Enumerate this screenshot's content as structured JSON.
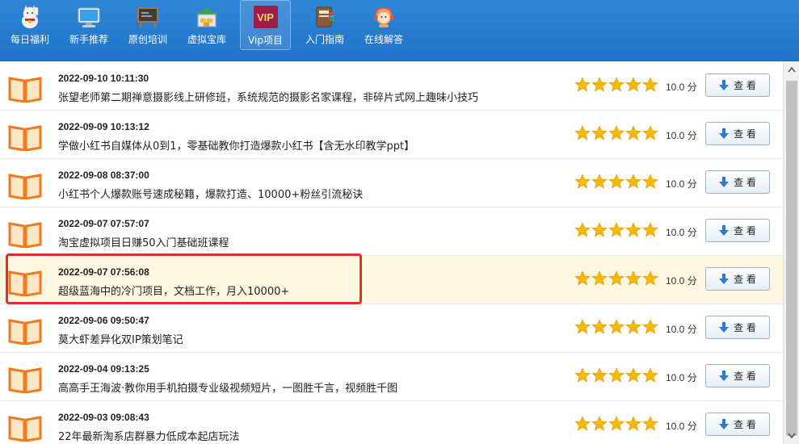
{
  "nav": {
    "items": [
      {
        "label": "每日福利",
        "icon": "lucky-cat-icon"
      },
      {
        "label": "新手推荐",
        "icon": "monitor-icon"
      },
      {
        "label": "原创培训",
        "icon": "blackboard-icon"
      },
      {
        "label": "虚拟宝库",
        "icon": "warehouse-icon"
      },
      {
        "label": "Vip项目",
        "icon": "vip-icon",
        "badge": "VIP",
        "active": true
      },
      {
        "label": "入门指南",
        "icon": "book-guide-icon"
      },
      {
        "label": "在线解答",
        "icon": "support-agent-icon"
      }
    ]
  },
  "list": {
    "view_label": "查 看",
    "rows": [
      {
        "date": "2022-09-10 10:11:30",
        "title": "张望老师第二期禅意摄影线上研修班，系统规范的摄影名家课程，非碎片式网上趣味小技巧",
        "rating": 5,
        "score": "10.0 分"
      },
      {
        "date": "2022-09-09 10:13:12",
        "title": "学做小红书自媒体从0到1，零基础教你打造爆款小红书【含无水印教学ppt】",
        "rating": 5,
        "score": "10.0 分"
      },
      {
        "date": "2022-09-08 08:37:00",
        "title": "小红书个人爆款账号速成秘籍，爆款打造、10000+粉丝引流秘诀",
        "rating": 5,
        "score": "10.0 分"
      },
      {
        "date": "2022-09-07 07:57:07",
        "title": "淘宝虚拟项目日赚50入门基础班课程",
        "rating": 5,
        "score": "10.0 分"
      },
      {
        "date": "2022-09-07 07:56:08",
        "title": "超级蓝海中的冷门项目，文档工作，月入10000+",
        "rating": 5,
        "score": "10.0 分",
        "highlight": true
      },
      {
        "date": "2022-09-06 09:50:47",
        "title": "莫大虾差异化双IP策划笔记",
        "rating": 5,
        "score": "10.0 分"
      },
      {
        "date": "2022-09-04 09:13:25",
        "title": "高高手王海波·教你用手机拍摄专业级视频短片，一图胜千言，视频胜千图",
        "rating": 5,
        "score": "10.0 分"
      },
      {
        "date": "2022-09-03 09:08:43",
        "title": "22年最新淘系店群暴力低成本起店玩法",
        "rating": 5,
        "score": "10.0 分"
      }
    ]
  },
  "colors": {
    "nav_bg": "#2478cc",
    "star": "#f5b800",
    "highlight_row": "#fdf7e1",
    "annotation_red": "#e52b2b",
    "book_orange": "#f07a1e"
  }
}
